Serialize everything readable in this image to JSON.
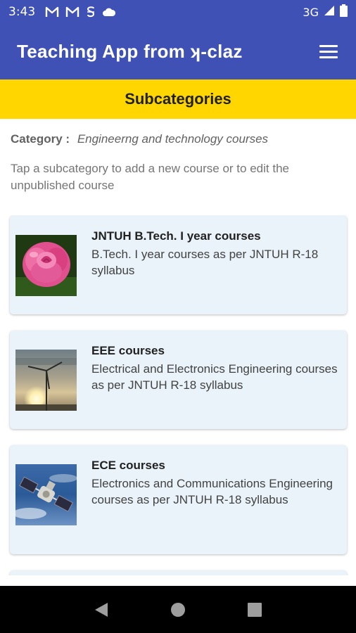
{
  "status_bar": {
    "time": "3:43",
    "network": "3G",
    "icons": [
      "gmail-icon",
      "gmail-icon",
      "s-app-icon",
      "cloud-icon",
      "signal-icon",
      "battery-icon"
    ]
  },
  "app_bar": {
    "title": "Teaching App from ʞ-claz",
    "menu_icon": "hamburger-menu-icon"
  },
  "sub_header": {
    "title": "Subcategories"
  },
  "category": {
    "label": "Category :",
    "value": "Engineerng and technology courses"
  },
  "hint": "Tap a subcategory to add a new course or to edit the unpublished course",
  "subcategories": [
    {
      "title": "JNTUH B.Tech. I year courses",
      "description": "B.Tech. I year courses as per JNTUH R-18 syllabus",
      "image": "pink-rose-image"
    },
    {
      "title": "EEE courses",
      "description": "Electrical and Electronics Engineering courses as per JNTUH R-18 syllabus",
      "image": "wind-turbine-sunset-image"
    },
    {
      "title": "ECE courses",
      "description": "Electronics and Communications Engineering courses as per JNTUH R-18 syllabus",
      "image": "satellite-image"
    }
  ],
  "nav_bar": {
    "icons": [
      "back-icon",
      "home-icon",
      "recents-icon"
    ]
  },
  "colors": {
    "primary": "#3f51b5",
    "accent": "#ffd600",
    "card_bg": "#eaf3fa"
  }
}
